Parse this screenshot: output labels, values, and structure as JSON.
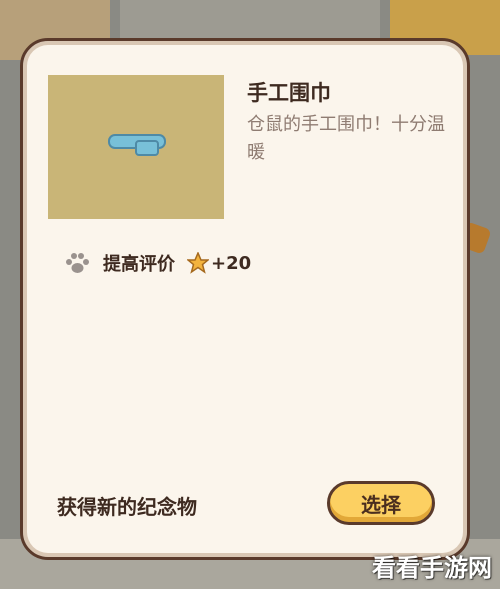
{
  "item": {
    "title": "手工围巾",
    "description": "仓鼠的手工围巾！十分温暖"
  },
  "reward": {
    "paw_icon": "paw-icon",
    "label": "提高评价",
    "star_icon": "star-icon",
    "value": "+20"
  },
  "footer": {
    "text": "获得新的纪念物",
    "choose_label": "选择"
  },
  "watermark": {
    "text": "看看手游网"
  },
  "colors": {
    "card_bg": "#fbf5ec",
    "border": "#5a3a2b",
    "button": "#fcd062",
    "text": "#3e2a20",
    "desc": "#8f7c72"
  }
}
